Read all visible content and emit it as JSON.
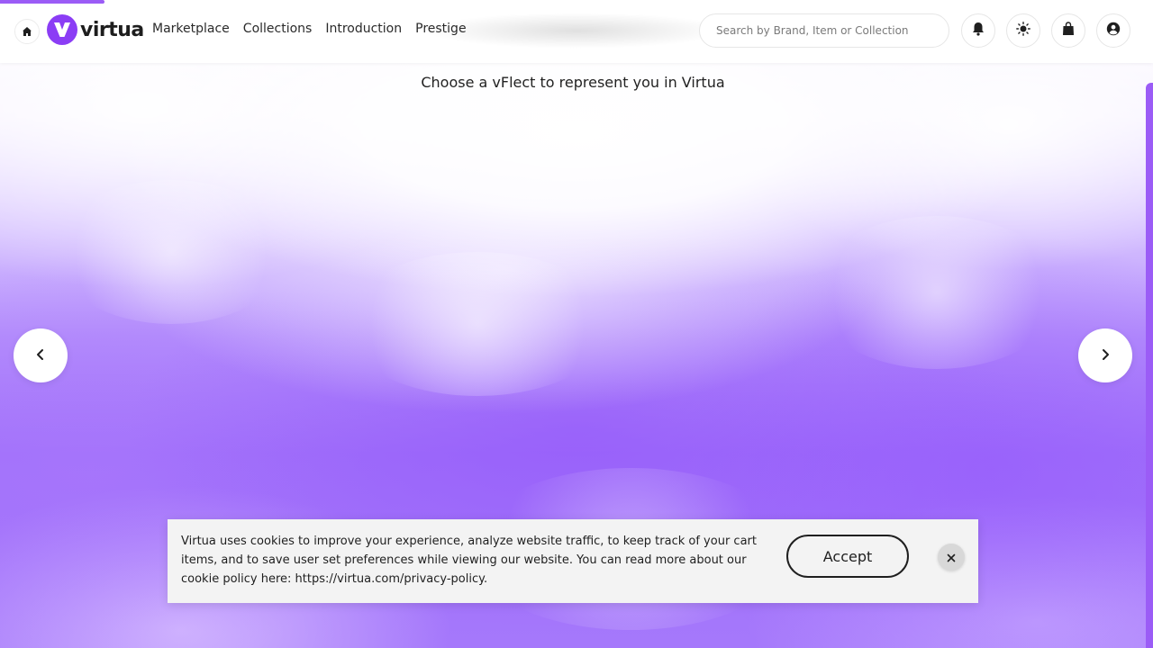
{
  "brand": {
    "name": "virtua",
    "accent": "#8b3df5"
  },
  "nav": {
    "items": [
      {
        "label": "Marketplace"
      },
      {
        "label": "Collections"
      },
      {
        "label": "Introduction"
      },
      {
        "label": "Prestige"
      }
    ]
  },
  "search": {
    "placeholder": "Search by Brand, Item or Collection",
    "value": ""
  },
  "header_icons": [
    "bell-icon",
    "sun-icon",
    "shopping-bag-icon",
    "user-icon"
  ],
  "main": {
    "subtitle": "Choose a vFlect to represent you in Virtua",
    "prev_icon": "chevron-left-icon",
    "next_icon": "chevron-right-icon"
  },
  "cookie": {
    "text": "Virtua uses cookies to improve your experience, analyze website traffic, to keep track of your cart items, and to save user set preferences while viewing our website. You can read more about our cookie policy here: https://virtua.com/privacy-policy.",
    "accept_label": "Accept",
    "close_icon": "close-icon"
  }
}
